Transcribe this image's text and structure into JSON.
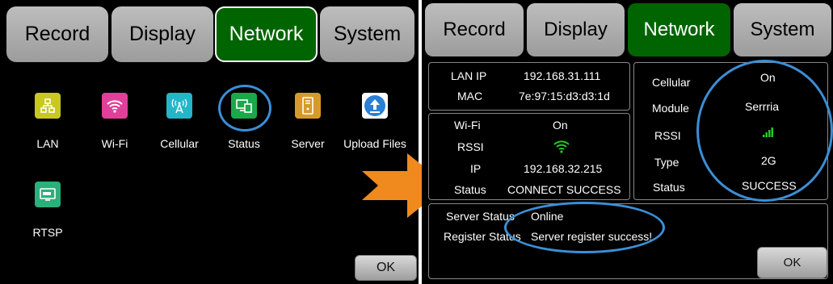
{
  "left": {
    "tabs": [
      "Record",
      "Display",
      "Network",
      "System"
    ],
    "apps": [
      {
        "label": "LAN",
        "icon": "lan-icon",
        "color": "#c8c81e"
      },
      {
        "label": "Wi-Fi",
        "icon": "wifi-icon",
        "color": "#e0409a"
      },
      {
        "label": "Cellular",
        "icon": "cellular-icon",
        "color": "#25b5c8"
      },
      {
        "label": "Status",
        "icon": "status-icon",
        "color": "#1aa84a"
      },
      {
        "label": "Server",
        "icon": "server-icon",
        "color": "#d79a2a"
      },
      {
        "label": "Upload Files",
        "icon": "upload-icon",
        "color": "#2a7fd6"
      },
      {
        "label": "RTSP",
        "icon": "rtsp-icon",
        "color": "#2ab07a"
      }
    ],
    "ok": "OK"
  },
  "right": {
    "tabs": [
      "Record",
      "Display",
      "Network",
      "System"
    ],
    "lan": {
      "ip_label": "LAN IP",
      "ip": "192.168.31.111",
      "mac_label": "MAC",
      "mac": "7e:97:15:d3:d3:1d"
    },
    "wifi": {
      "wifi_label": "Wi-Fi",
      "wifi": "On",
      "rssi_label": "RSSI",
      "ip_label": "IP",
      "ip": "192.168.32.215",
      "status_label": "Status",
      "status": "CONNECT SUCCESS"
    },
    "cell": {
      "cellular_label": "Cellular",
      "cellular": "On",
      "module_label": "Module",
      "module": "Serrria",
      "rssi_label": "RSSI",
      "type_label": "Type",
      "type": "2G",
      "status_label": "Status",
      "status": "SUCCESS"
    },
    "server": {
      "server_status_label": "Server Status",
      "server_status": "Online",
      "register_label": "Register Status",
      "register": "Server register success!"
    },
    "ok": "OK"
  },
  "colors": {
    "active_tab": "#006400",
    "highlight_ring": "#3b8fd6",
    "arrow": "#f08a1e",
    "wifi_signal": "#22cc22"
  }
}
